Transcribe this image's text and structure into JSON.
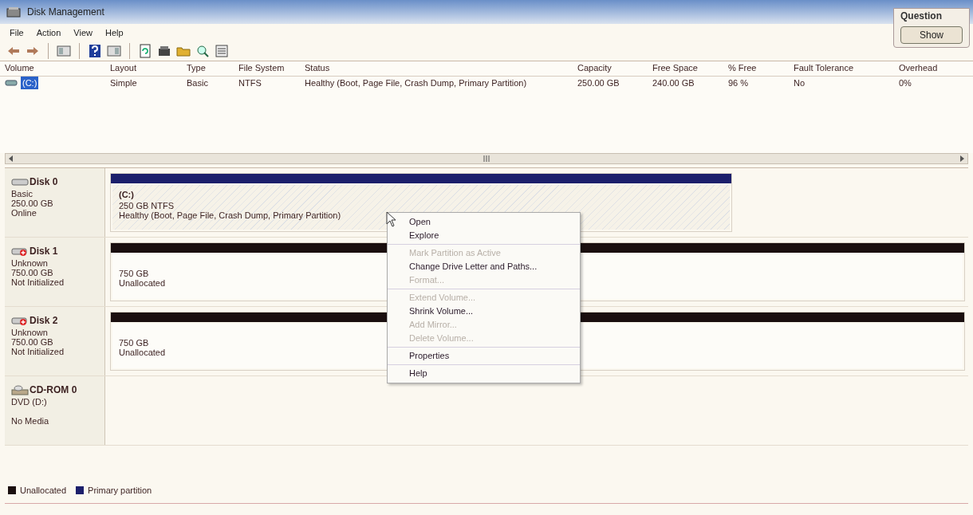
{
  "window": {
    "title": "Disk Management"
  },
  "question": {
    "title": "Question",
    "button": "Show"
  },
  "menu": [
    "File",
    "Action",
    "View",
    "Help"
  ],
  "toolbar": [
    {
      "kind": "back"
    },
    {
      "kind": "forward"
    },
    {
      "kind": "sep"
    },
    {
      "kind": "panel"
    },
    {
      "kind": "sep"
    },
    {
      "kind": "help"
    },
    {
      "kind": "panel2"
    },
    {
      "kind": "sep"
    },
    {
      "kind": "refresh"
    },
    {
      "kind": "disk"
    },
    {
      "kind": "folder"
    },
    {
      "kind": "magnifier"
    },
    {
      "kind": "checklist"
    }
  ],
  "volumes": {
    "columns": [
      "Volume",
      "Layout",
      "Type",
      "File System",
      "Status",
      "Capacity",
      "Free Space",
      "% Free",
      "Fault Tolerance",
      "Overhead"
    ],
    "rows": [
      {
        "selected": true,
        "cells": [
          "(C:)",
          "Simple",
          "Basic",
          "NTFS",
          "Healthy (Boot, Page File, Crash Dump, Primary Partition)",
          "250.00 GB",
          "240.00 GB",
          "96 %",
          "No",
          "0%"
        ]
      }
    ]
  },
  "disks": [
    {
      "kind": "disk",
      "name": "Disk 0",
      "lines": [
        "Basic",
        "250.00 GB",
        "Online"
      ],
      "partitions": [
        {
          "kind": "primary",
          "selected": true,
          "title": "(C:)",
          "lines": [
            "250 GB NTFS",
            "Healthy (Boot, Page File, Crash Dump, Primary Partition)"
          ]
        }
      ]
    },
    {
      "kind": "disk-warning",
      "name": "Disk 1",
      "lines": [
        "Unknown",
        "750.00 GB",
        "Not Initialized"
      ],
      "partitions": [
        {
          "kind": "unallocated",
          "selected": false,
          "lines": [
            "750 GB",
            "Unallocated"
          ]
        }
      ]
    },
    {
      "kind": "disk-warning",
      "name": "Disk 2",
      "lines": [
        "Unknown",
        "750.00 GB",
        "Not Initialized"
      ],
      "partitions": [
        {
          "kind": "unallocated",
          "selected": false,
          "lines": [
            "750 GB",
            "Unallocated"
          ]
        }
      ]
    },
    {
      "kind": "cdrom",
      "name": "CD-ROM 0",
      "lines": [
        "DVD (D:)",
        "No Media"
      ]
    }
  ],
  "context_menu": [
    [
      {
        "label": "Open",
        "disabled": false
      },
      {
        "label": "Explore",
        "disabled": false
      }
    ],
    [
      {
        "label": "Mark Partition as Active",
        "disabled": true
      },
      {
        "label": "Change Drive Letter and Paths...",
        "disabled": false
      },
      {
        "label": "Format...",
        "disabled": true
      }
    ],
    [
      {
        "label": "Extend Volume...",
        "disabled": true
      },
      {
        "label": "Shrink Volume...",
        "disabled": false
      },
      {
        "label": "Add Mirror...",
        "disabled": true
      },
      {
        "label": "Delete Volume...",
        "disabled": true
      }
    ],
    [
      {
        "label": "Properties",
        "disabled": false
      }
    ],
    [
      {
        "label": "Help",
        "disabled": false
      }
    ]
  ],
  "legend": [
    {
      "label": "Unallocated",
      "color": "#1a0f0f"
    },
    {
      "label": "Primary partition",
      "color": "#1c1f6b"
    }
  ]
}
